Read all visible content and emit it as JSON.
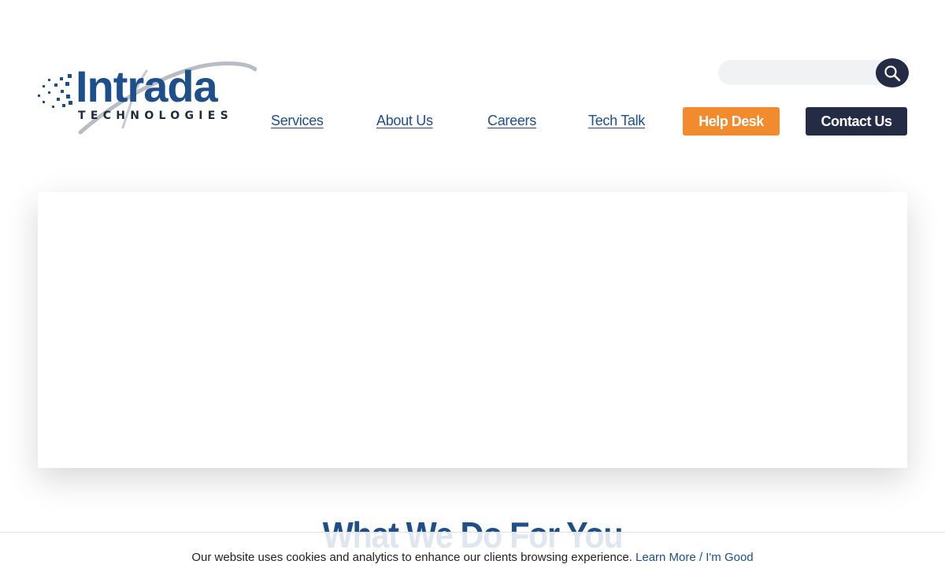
{
  "brand": {
    "name": "Intrada",
    "tagline": "TECHNOLOGIES",
    "primary_color": "#1c4f8b",
    "accent_color": "#f28a2e",
    "dark_color": "#232c44"
  },
  "search": {
    "placeholder": "",
    "value": "",
    "icon": "search-icon"
  },
  "nav": {
    "links": [
      {
        "label": "Services"
      },
      {
        "label": "About Us"
      },
      {
        "label": "Careers"
      },
      {
        "label": "Tech Talk"
      }
    ],
    "help_desk_label": "Help Desk",
    "contact_label": "Contact Us"
  },
  "main": {
    "section_heading": "What We Do For You"
  },
  "cookie_banner": {
    "message": "Our website uses cookies and analytics to enhance our clients browsing experience.",
    "learn_more": "Learn More",
    "separator": "/",
    "dismiss": "I'm Good"
  }
}
